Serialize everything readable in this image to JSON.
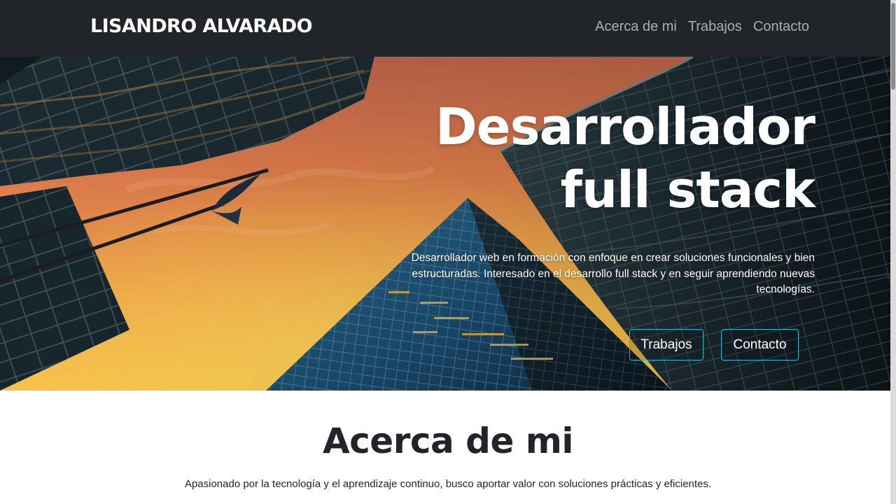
{
  "navbar": {
    "brand": "LISANDRO ALVARADO",
    "links": [
      "Acerca de mi",
      "Trabajos",
      "Contacto"
    ]
  },
  "hero": {
    "title_line1": "Desarrollador",
    "title_line2": "full stack",
    "description": "Desarrollador web en formación con enfoque en crear soluciones funcionales y bien estructuradas. Interesado en el desarrollo full stack y en seguir aprendiendo nuevas tecnologías.",
    "buttons": [
      "Trabajos",
      "Contacto"
    ],
    "button_border_color": "#2bb6d4",
    "background_image": "skyscrapers-sunset-icon"
  },
  "about": {
    "title": "Acerca de mi",
    "text": "Apasionado por la tecnología y el aprendizaje continuo, busco aportar valor con soluciones prácticas y eficientes."
  },
  "colors": {
    "navbar_bg": "#212529",
    "nav_link": "#9a9da0",
    "text_dark": "#212529"
  }
}
